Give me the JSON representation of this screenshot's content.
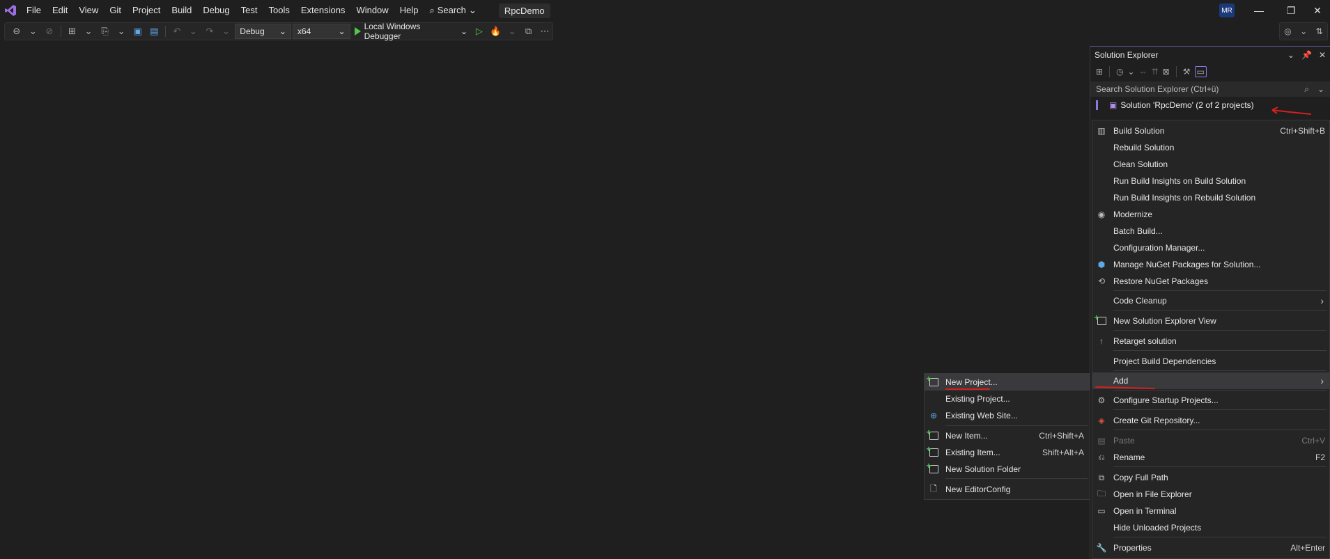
{
  "menubar": {
    "items": [
      "File",
      "Edit",
      "View",
      "Git",
      "Project",
      "Build",
      "Debug",
      "Test",
      "Tools",
      "Extensions",
      "Window",
      "Help"
    ],
    "search_label": "Search",
    "project_name": "RpcDemo",
    "avatar_initials": "MR"
  },
  "toolbar": {
    "config": "Debug",
    "platform": "x64",
    "debugger": "Local Windows Debugger"
  },
  "solution_explorer": {
    "title": "Solution Explorer",
    "search_placeholder": "Search Solution Explorer (Ctrl+ü)",
    "root_label": "Solution 'RpcDemo' (2 of 2 projects)"
  },
  "context_menu": {
    "items": [
      {
        "label": "Build Solution",
        "shortcut": "Ctrl+Shift+B",
        "icon": "build-icon"
      },
      {
        "label": "Rebuild Solution",
        "shortcut": ""
      },
      {
        "label": "Clean Solution",
        "shortcut": ""
      },
      {
        "label": "Run Build Insights on Build Solution",
        "shortcut": ""
      },
      {
        "label": "Run Build Insights on Rebuild Solution",
        "shortcut": ""
      },
      {
        "label": "Modernize",
        "shortcut": "",
        "icon": "copilot-icon"
      },
      {
        "label": "Batch Build...",
        "shortcut": ""
      },
      {
        "label": "Configuration Manager...",
        "shortcut": ""
      },
      {
        "label": "Manage NuGet Packages for Solution...",
        "shortcut": "",
        "icon": "nuget-icon"
      },
      {
        "label": "Restore NuGet Packages",
        "shortcut": "",
        "icon": "restore-icon"
      },
      {
        "label": "Code Cleanup",
        "shortcut": "",
        "submenu": true
      },
      {
        "label": "New Solution Explorer View",
        "shortcut": "",
        "icon": "new-view-icon"
      },
      {
        "label": "Retarget solution",
        "shortcut": "",
        "icon": "arrow-up-icon"
      },
      {
        "label": "Project Build Dependencies",
        "shortcut": ""
      },
      {
        "label": "Add",
        "shortcut": "",
        "submenu": true
      },
      {
        "label": "Configure Startup Projects...",
        "shortcut": "",
        "icon": "gear-icon"
      },
      {
        "label": "Create Git Repository...",
        "shortcut": "",
        "icon": "git-icon"
      },
      {
        "label": "Paste",
        "shortcut": "Ctrl+V",
        "disabled": true,
        "icon": "paste-icon"
      },
      {
        "label": "Rename",
        "shortcut": "F2",
        "icon": "rename-icon"
      },
      {
        "label": "Copy Full Path",
        "shortcut": "",
        "icon": "copy-icon"
      },
      {
        "label": "Open in File Explorer",
        "shortcut": "",
        "icon": "folder-icon"
      },
      {
        "label": "Open in Terminal",
        "shortcut": "",
        "icon": "terminal-icon"
      },
      {
        "label": "Hide Unloaded Projects",
        "shortcut": ""
      },
      {
        "label": "Properties",
        "shortcut": "Alt+Enter",
        "icon": "wrench-icon"
      }
    ]
  },
  "add_submenu": {
    "items": [
      {
        "label": "New Project...",
        "shortcut": ""
      },
      {
        "label": "Existing Project...",
        "shortcut": ""
      },
      {
        "label": "Existing Web Site...",
        "shortcut": ""
      },
      {
        "label": "New Item...",
        "shortcut": "Ctrl+Shift+A"
      },
      {
        "label": "Existing Item...",
        "shortcut": "Shift+Alt+A"
      },
      {
        "label": "New Solution Folder",
        "shortcut": ""
      },
      {
        "label": "New EditorConfig",
        "shortcut": ""
      }
    ]
  }
}
